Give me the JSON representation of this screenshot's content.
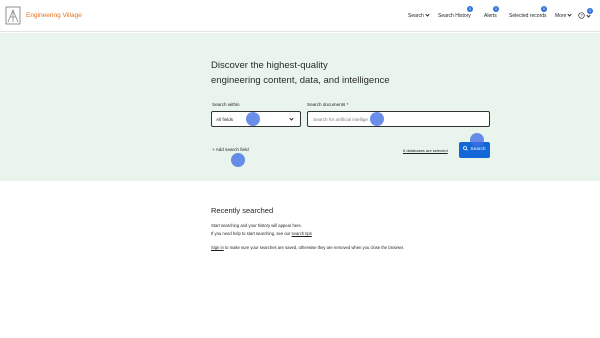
{
  "header": {
    "brand": "Engineering Village",
    "nav": {
      "search": "Search",
      "search_history": "Search History",
      "alerts": "Alerts",
      "selected_records": "Selected records",
      "more": "More"
    },
    "badges": {
      "search_history": "0",
      "alerts": "0",
      "selected_records": "0",
      "help": "0"
    }
  },
  "hero": {
    "headline_line1": "Discover the highest-quality",
    "headline_line2": "engineering content, data, and intelligence",
    "search_within_label": "Search within",
    "search_within_value": "All fields",
    "search_documents_label": "Search documents *",
    "query_placeholder": "Search for artificial intellige",
    "add_field": "+ Add search field",
    "databases_link": "6 databases are selected",
    "search_button": "Search"
  },
  "recent": {
    "title": "Recently searched",
    "line1": "Start searching and your history will appear here.",
    "line2_prefix": "If you need help to start searching, see our ",
    "line2_link": "search tips",
    "line3_link": "Sign in",
    "line3_suffix": " to make sure your searches are saved, otherwise they are removed when you close the browser."
  },
  "colors": {
    "brand": "#e9711c",
    "hero_bg": "#e8f4ec",
    "primary_button": "#1467d6",
    "badge": "#2f73da"
  }
}
